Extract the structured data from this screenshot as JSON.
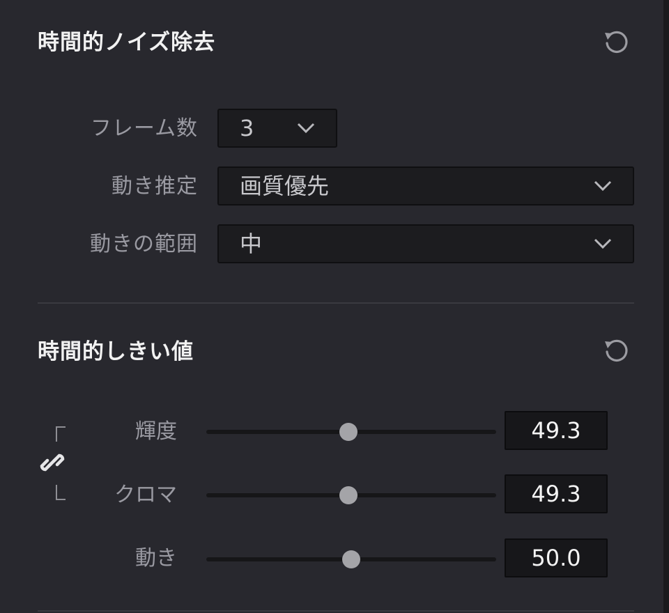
{
  "temporal_nr": {
    "title": "時間的ノイズ除去",
    "frames": {
      "label": "フレーム数",
      "value": "3"
    },
    "motion_estimation": {
      "label": "動き推定",
      "value": "画質優先"
    },
    "motion_range": {
      "label": "動きの範囲",
      "value": "中"
    }
  },
  "temporal_threshold": {
    "title": "時間的しきい値",
    "luma": {
      "label": "輝度",
      "value": "49.3",
      "level": 0.49
    },
    "chroma": {
      "label": "クロマ",
      "value": "49.3",
      "level": 0.49
    },
    "motion": {
      "label": "動き",
      "value": "50.0",
      "level": 0.5
    }
  },
  "icons": [
    "reset-icon",
    "chevron-down-icon",
    "link-icon"
  ],
  "colors": {
    "panel": "#28282e",
    "text": "#f2f2f2",
    "label": "#9a9aa2",
    "thumb": "#a4a4a8"
  }
}
